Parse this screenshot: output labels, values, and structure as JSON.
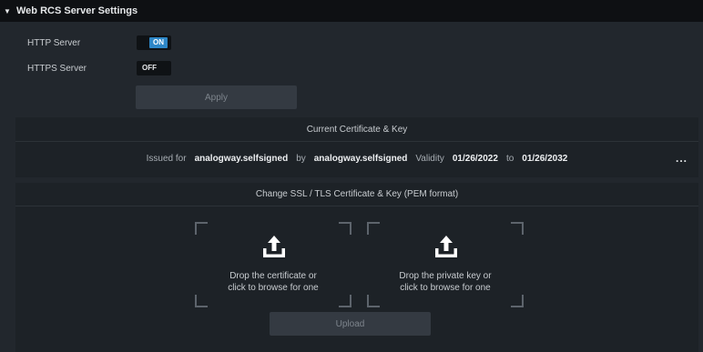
{
  "header": {
    "title": "Web RCS Server Settings"
  },
  "http": {
    "label": "HTTP Server",
    "toggle": "ON"
  },
  "https": {
    "label": "HTTPS Server",
    "toggle": "OFF"
  },
  "apply_label": "Apply",
  "current_cert": {
    "title": "Current Certificate & Key",
    "issued_for_label": "Issued for",
    "issued_for": "analogway.selfsigned",
    "by_label": "by",
    "by": "analogway.selfsigned",
    "validity_label": "Validity",
    "valid_from": "01/26/2022",
    "to_label": "to",
    "valid_to": "01/26/2032",
    "more": "..."
  },
  "change_cert": {
    "title": "Change SSL / TLS Certificate & Key (PEM format)",
    "certificate_drop": {
      "line1": "Drop the certificate or",
      "line2": "click to browse for one"
    },
    "key_drop": {
      "line1": "Drop the private key or",
      "line2": "click to browse for one"
    },
    "upload_label": "Upload"
  },
  "colors": {
    "accent": "#2e87c7",
    "header_bg": "#0e1013",
    "panel_bg": "#22272d"
  }
}
